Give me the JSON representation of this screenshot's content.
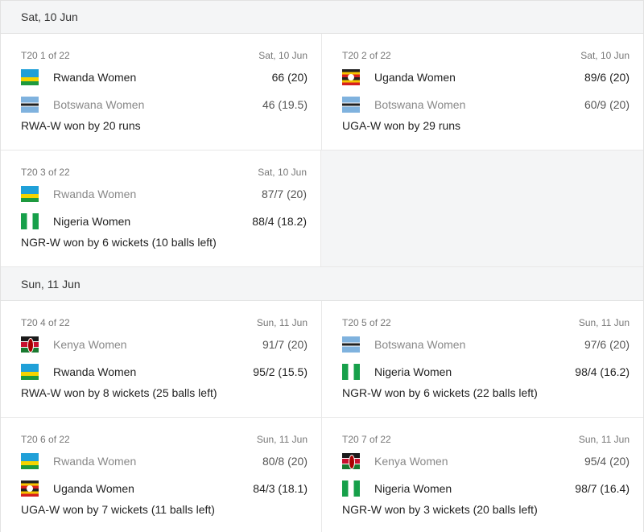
{
  "days": [
    {
      "label": "Sat, 10 Jun",
      "matches": [
        {
          "series": "T20 1 of 22",
          "date": "Sat, 10 Jun",
          "team1": {
            "name": "Rwanda Women",
            "score": "66 (20)",
            "flag": "rwanda-flag-icon",
            "loser": false
          },
          "team2": {
            "name": "Botswana Women",
            "score": "46 (19.5)",
            "flag": "botswana-flag-icon",
            "loser": true
          },
          "result": "RWA-W won by 20 runs"
        },
        {
          "series": "T20 2 of 22",
          "date": "Sat, 10 Jun",
          "team1": {
            "name": "Uganda Women",
            "score": "89/6 (20)",
            "flag": "uganda-flag-icon",
            "loser": false
          },
          "team2": {
            "name": "Botswana Women",
            "score": "60/9 (20)",
            "flag": "botswana-flag-icon",
            "loser": true
          },
          "result": "UGA-W won by 29 runs"
        },
        {
          "series": "T20 3 of 22",
          "date": "Sat, 10 Jun",
          "team1": {
            "name": "Rwanda Women",
            "score": "87/7 (20)",
            "flag": "rwanda-flag-icon",
            "loser": true
          },
          "team2": {
            "name": "Nigeria Women",
            "score": "88/4 (18.2)",
            "flag": "nigeria-flag-icon",
            "loser": false
          },
          "result": "NGR-W won by 6 wickets (10 balls left)"
        }
      ]
    },
    {
      "label": "Sun, 11 Jun",
      "matches": [
        {
          "series": "T20 4 of 22",
          "date": "Sun, 11 Jun",
          "team1": {
            "name": "Kenya Women",
            "score": "91/7 (20)",
            "flag": "kenya-flag-icon",
            "loser": true
          },
          "team2": {
            "name": "Rwanda Women",
            "score": "95/2 (15.5)",
            "flag": "rwanda-flag-icon",
            "loser": false
          },
          "result": "RWA-W won by 8 wickets (25 balls left)"
        },
        {
          "series": "T20 5 of 22",
          "date": "Sun, 11 Jun",
          "team1": {
            "name": "Botswana Women",
            "score": "97/6 (20)",
            "flag": "botswana-flag-icon",
            "loser": true
          },
          "team2": {
            "name": "Nigeria Women",
            "score": "98/4 (16.2)",
            "flag": "nigeria-flag-icon",
            "loser": false
          },
          "result": "NGR-W won by 6 wickets (22 balls left)"
        },
        {
          "series": "T20 6 of 22",
          "date": "Sun, 11 Jun",
          "team1": {
            "name": "Rwanda Women",
            "score": "80/8 (20)",
            "flag": "rwanda-flag-icon",
            "loser": true
          },
          "team2": {
            "name": "Uganda Women",
            "score": "84/3 (18.1)",
            "flag": "uganda-flag-icon",
            "loser": false
          },
          "result": "UGA-W won by 7 wickets (11 balls left)"
        },
        {
          "series": "T20 7 of 22",
          "date": "Sun, 11 Jun",
          "team1": {
            "name": "Kenya Women",
            "score": "95/4 (20)",
            "flag": "kenya-flag-icon",
            "loser": true
          },
          "team2": {
            "name": "Nigeria Women",
            "score": "98/7 (16.4)",
            "flag": "nigeria-flag-icon",
            "loser": false
          },
          "result": "NGR-W won by 3 wickets (20 balls left)"
        }
      ]
    }
  ]
}
